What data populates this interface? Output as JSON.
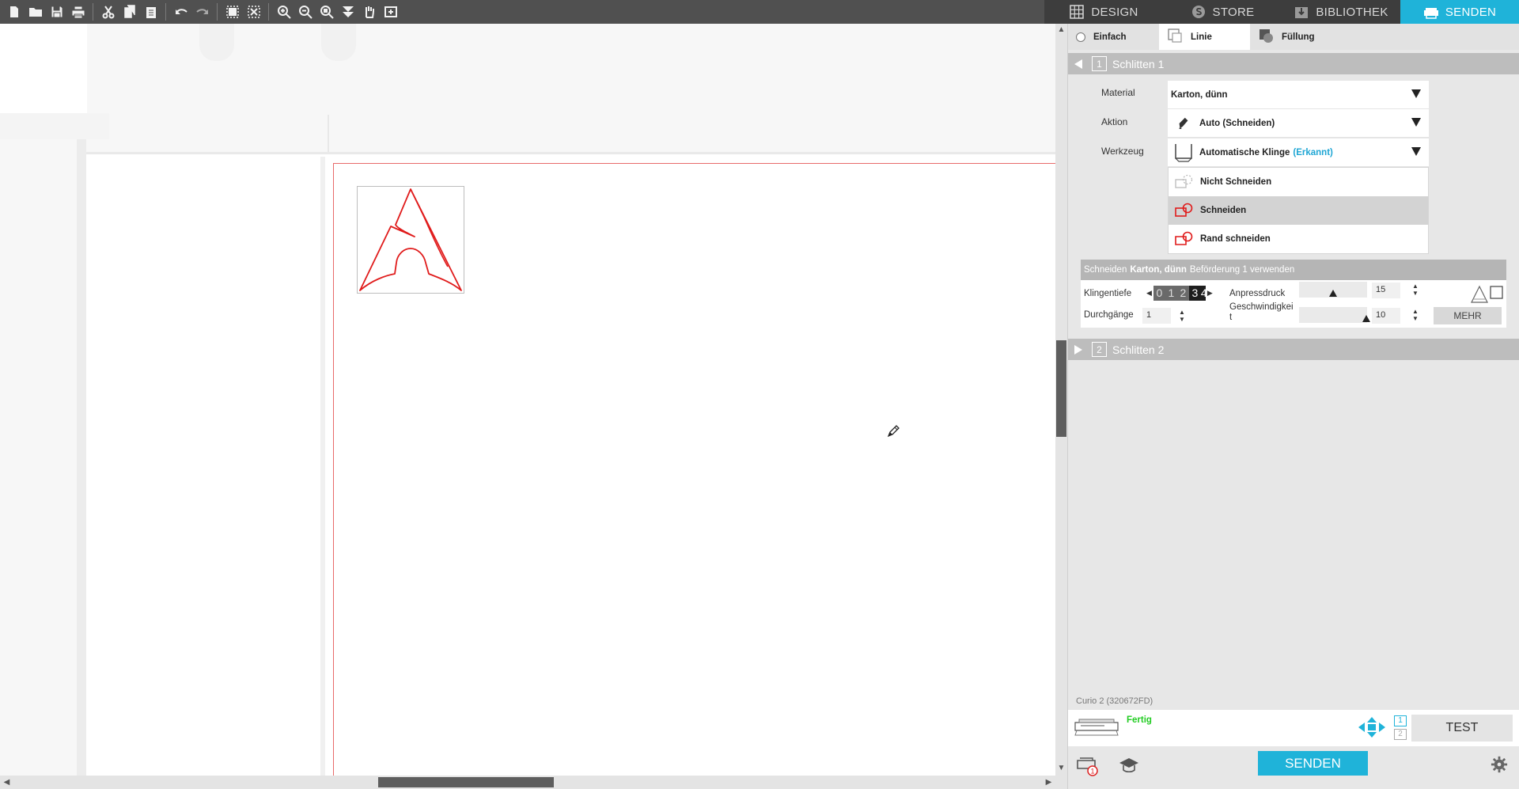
{
  "toolbar": {
    "buttons": [
      "new-file",
      "open-file",
      "save",
      "print",
      "cut",
      "copy",
      "paste",
      "undo",
      "redo",
      "group",
      "ungroup",
      "zoom-in",
      "zoom-out",
      "zoom-fit",
      "move-down",
      "pan",
      "add-page"
    ]
  },
  "top_tabs": [
    {
      "label": "DESIGN",
      "icon": "grid-icon"
    },
    {
      "label": "STORE",
      "icon": "store-icon"
    },
    {
      "label": "BIBLIOTHEK",
      "icon": "library-icon"
    },
    {
      "label": "SENDEN",
      "icon": "cutter-icon",
      "active": true
    }
  ],
  "mode_tabs": {
    "einfach": "Einfach",
    "linie": "Linie",
    "fuellung": "Füllung"
  },
  "carriage1": {
    "num": "1",
    "label": "Schlitten 1"
  },
  "carriage2": {
    "num": "2",
    "label": "Schlitten 2"
  },
  "fields": {
    "material_label": "Material",
    "material_value": "Karton, dünn",
    "aktion_label": "Aktion",
    "aktion_value": "Auto (Schneiden)",
    "werkzeug_label": "Werkzeug",
    "werkzeug_value": "Automatische Klinge",
    "werkzeug_status": "(Erkannt)"
  },
  "cut_options": [
    {
      "label": "Nicht Schneiden",
      "selected": false
    },
    {
      "label": "Schneiden",
      "selected": true
    },
    {
      "label": "Rand schneiden",
      "selected": false
    }
  ],
  "info_bar": {
    "prefix": "Schneiden",
    "material": "Karton, dünn",
    "suffix": "Beförderung 1 verwenden"
  },
  "settings": {
    "klingentiefe_label": "Klingentiefe",
    "depth_digits": [
      "0",
      "1",
      "2",
      "3",
      "4"
    ],
    "anpressdruck_label": "Anpressdruck",
    "anpressdruck_value": "15",
    "durchgaenge_label": "Durchgänge",
    "durchgaenge_value": "1",
    "geschwindigkeit_label_1": "Geschwindigkei",
    "geschwindigkeit_label_2": "t",
    "geschwindigkeit_value": "10",
    "mehr_label": "MEHR"
  },
  "device": {
    "name": "Curio 2 (320672FD)",
    "status": "Fertig",
    "page1": "1",
    "page2": "2",
    "test_label": "TEST"
  },
  "send_label": "SENDEN",
  "colors": {
    "accent": "#1fb3d9",
    "cut_line": "#e01b1b",
    "status_ok": "#22cc22"
  }
}
